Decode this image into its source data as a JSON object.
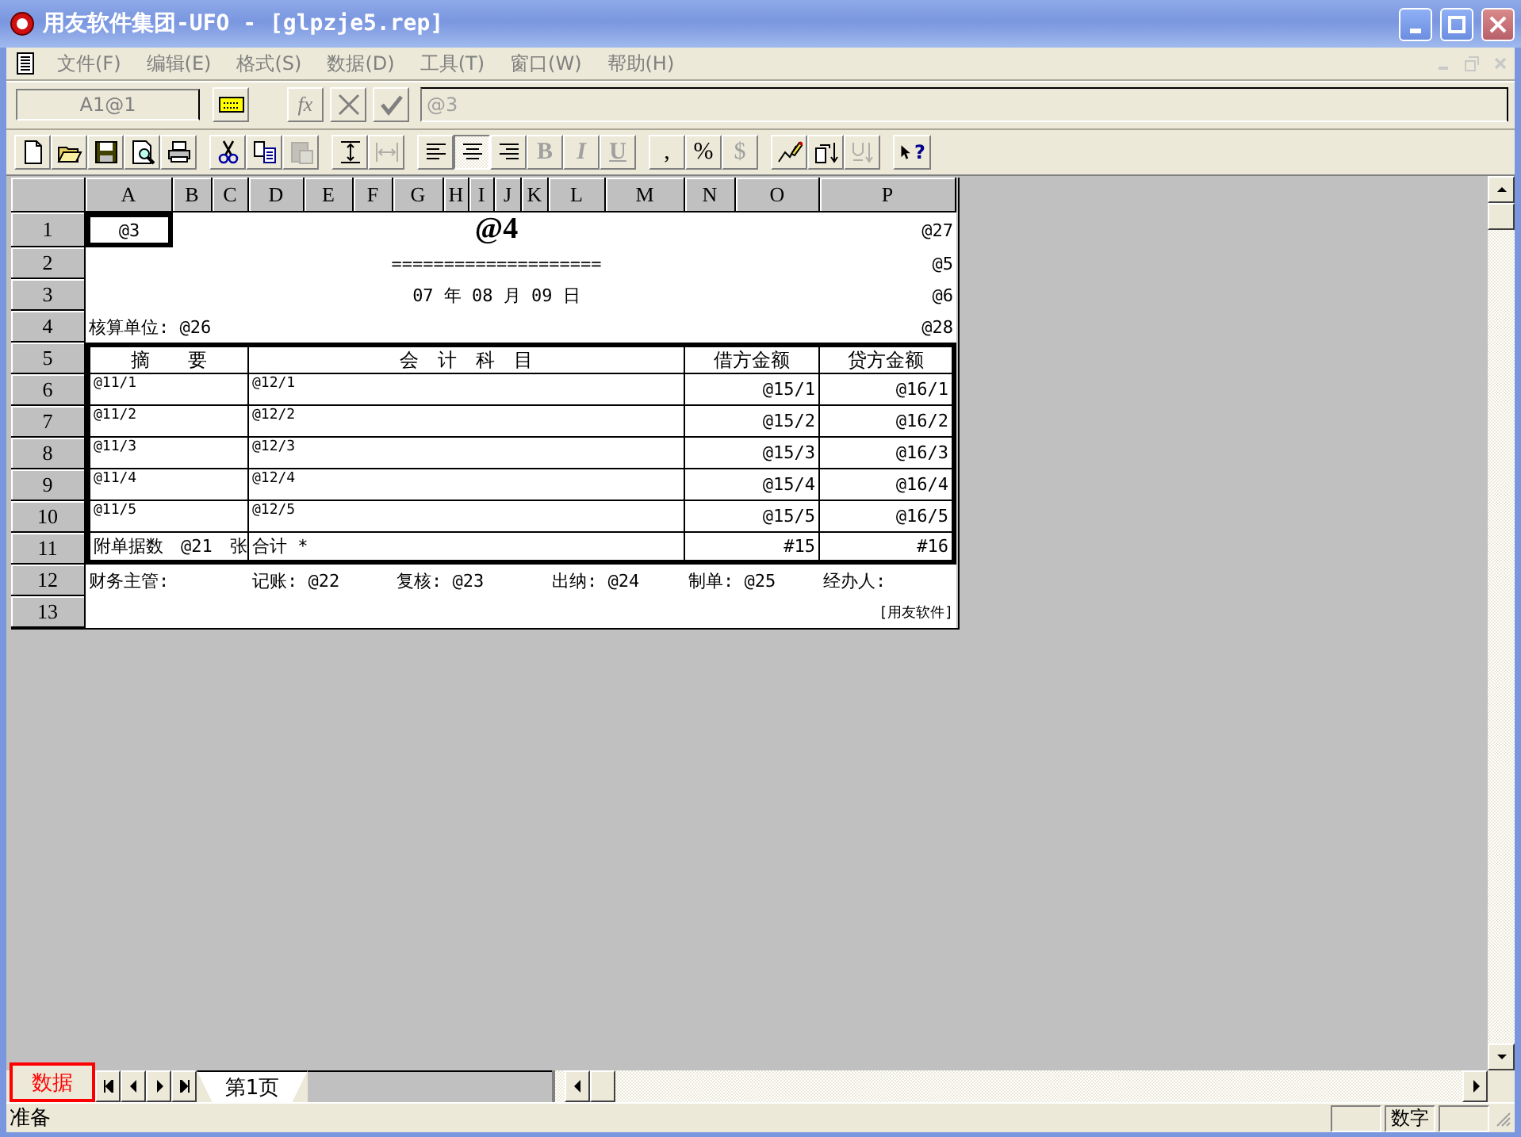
{
  "window": {
    "title": "用友软件集团-UFO - [glpzje5.rep]"
  },
  "menu": [
    "文件(F)",
    "编辑(E)",
    "格式(S)",
    "数据(D)",
    "工具(T)",
    "窗口(W)",
    "帮助(H)"
  ],
  "formula_bar": {
    "cell_ref": "A1@1",
    "function_button": "fx",
    "value": "@3"
  },
  "toolbar": [
    [
      {
        "kind": "new",
        "disabled": false
      },
      {
        "kind": "open",
        "disabled": false
      },
      {
        "kind": "save",
        "disabled": false
      },
      {
        "kind": "preview",
        "disabled": false
      },
      {
        "kind": "print",
        "disabled": false
      }
    ],
    [
      {
        "kind": "cut",
        "disabled": false
      },
      {
        "kind": "copy",
        "disabled": false
      },
      {
        "kind": "paste",
        "disabled": true
      }
    ],
    [
      {
        "kind": "row-height",
        "disabled": false
      },
      {
        "kind": "col-width",
        "disabled": true
      }
    ],
    [
      {
        "kind": "align-left",
        "disabled": false,
        "pressed": false
      },
      {
        "kind": "align-center",
        "disabled": false,
        "pressed": true
      },
      {
        "kind": "align-right",
        "disabled": false,
        "pressed": false
      },
      {
        "kind": "bold",
        "glyph": "B",
        "disabled": true
      },
      {
        "kind": "italic",
        "glyph": "I",
        "disabled": true
      },
      {
        "kind": "underline",
        "glyph": "U",
        "disabled": true
      }
    ],
    [
      {
        "kind": "comma",
        "glyph": ",",
        "disabled": false
      },
      {
        "kind": "percent",
        "glyph": "%",
        "disabled": false
      },
      {
        "kind": "currency",
        "glyph": "$",
        "disabled": true
      }
    ],
    [
      {
        "kind": "pencil",
        "disabled": false
      },
      {
        "kind": "sort-pages",
        "disabled": false
      },
      {
        "kind": "sort",
        "disabled": true
      }
    ],
    [
      {
        "kind": "help",
        "glyph": "?",
        "disabled": false
      }
    ]
  ],
  "sheet": {
    "columns": [
      "A",
      "B",
      "C",
      "D",
      "E",
      "F",
      "G",
      "H",
      "I",
      "J",
      "K",
      "L",
      "M",
      "N",
      "O",
      "P"
    ],
    "row_headers": [
      "1",
      "2",
      "3",
      "4",
      "5",
      "6",
      "7",
      "8",
      "9",
      "10",
      "11",
      "12",
      "13"
    ],
    "heading_lines": [
      {
        "kind": "title",
        "parts": [
          {
            "kind": "cell",
            "text": "@3",
            "selected": true
          },
          {
            "kind": "center",
            "text": "@4",
            "selected": false
          },
          {
            "kind": "note",
            "text": "@27",
            "selected": false
          }
        ]
      },
      {
        "kind": "rule",
        "parts": [
          {
            "kind": "center",
            "text": "====================",
            "selected": false
          },
          {
            "kind": "note",
            "text": "@5",
            "selected": false
          }
        ]
      },
      {
        "kind": "date",
        "parts": [
          {
            "kind": "center",
            "text": "07 年 08 月 09 日",
            "selected": false
          },
          {
            "kind": "note",
            "text": "@6",
            "selected": false
          }
        ]
      },
      {
        "kind": "unit",
        "parts": [
          {
            "kind": "label",
            "text": "核算单位: @26",
            "selected": false
          },
          {
            "kind": "note",
            "text": "@28",
            "selected": false
          }
        ]
      }
    ],
    "voucher_table": {
      "columns": [
        "摘　　要",
        "会　计　科　目",
        "借方金额",
        "贷方金额"
      ],
      "rows": [
        [
          "@11/1",
          "@12/1",
          "@15/1",
          "@16/1"
        ],
        [
          "@11/2",
          "@12/2",
          "@15/2",
          "@16/2"
        ],
        [
          "@11/3",
          "@12/3",
          "@15/3",
          "@16/3"
        ],
        [
          "@11/4",
          "@12/4",
          "@15/4",
          "@16/4"
        ],
        [
          "@11/5",
          "@12/5",
          "@15/5",
          "@16/5"
        ]
      ],
      "total": [
        "附单据数　@21　张",
        "合计 *",
        "#15",
        "#16"
      ]
    },
    "signatures": [
      "财务主管:",
      "记账: @22",
      "复核: @23",
      "出纳: @24",
      "制单: @25",
      "经办人:"
    ],
    "footer": "[用友软件]"
  },
  "sheet_tabs": {
    "mode": "数据",
    "tabs": [
      {
        "label": "第1页",
        "selected": true
      }
    ]
  },
  "status_bar": {
    "message": "准备",
    "panels": [
      "数字"
    ]
  }
}
